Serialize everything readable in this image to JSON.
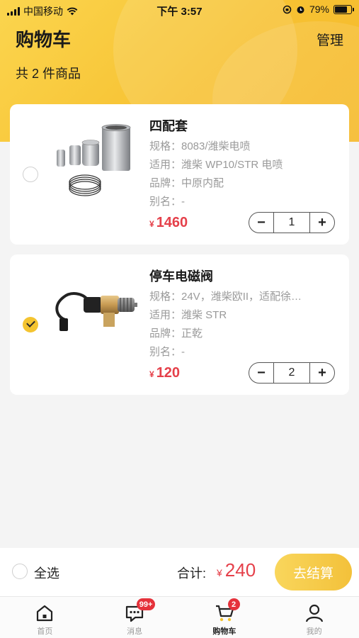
{
  "status_bar": {
    "carrier": "中国移动",
    "time": "下午 3:57",
    "battery": "79%",
    "battery_level": 0.79
  },
  "header": {
    "title": "购物车",
    "manage_label": "管理",
    "item_count": "共 2 件商品"
  },
  "items": [
    {
      "name": "四配套",
      "spec": "规格：8083/潍柴电喷",
      "fit": "适用：潍柴 WP10/STR 电喷",
      "brand": "品牌：中原内配",
      "alias": "别名：-",
      "currency": "¥",
      "price": "1460",
      "quantity": "1",
      "selected": false,
      "image_icon": "piston-kit-image"
    },
    {
      "name": "停车电磁阀",
      "spec": "规格：24V，潍柴欧II，适配徐…",
      "fit": "适用：潍柴 STR",
      "brand": "品牌：正乾",
      "alias": "别名：-",
      "currency": "¥",
      "price": "120",
      "quantity": "2",
      "selected": true,
      "image_icon": "solenoid-valve-image"
    }
  ],
  "stepper": {
    "minus": "−",
    "plus": "+"
  },
  "checkout": {
    "select_all": "全选",
    "total_label": "合计:",
    "currency": "¥",
    "total": "240",
    "pay_label": "去结算"
  },
  "tabbar": [
    {
      "label": "首页",
      "icon": "home-icon",
      "badge": ""
    },
    {
      "label": "消息",
      "icon": "message-icon",
      "badge": "99+"
    },
    {
      "label": "购物车",
      "icon": "cart-icon",
      "badge": "2"
    },
    {
      "label": "我的",
      "icon": "user-icon",
      "badge": ""
    }
  ],
  "colors": {
    "accent": "#f4c430",
    "price": "#e5404a",
    "badge": "#e5323b"
  }
}
